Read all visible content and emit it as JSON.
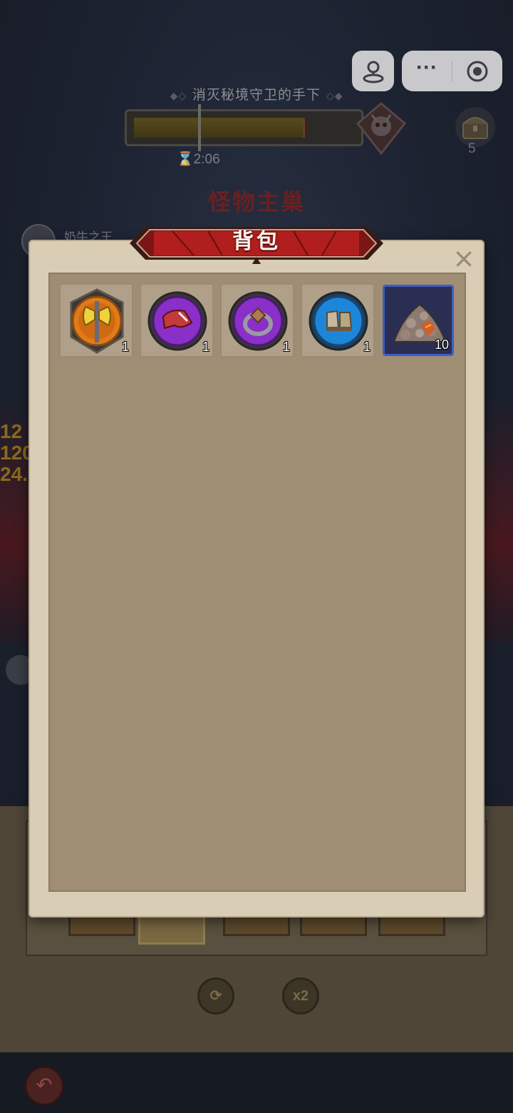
{
  "hud": {
    "mission_title": "消灭秘境守卫的手下",
    "timer": "2:06",
    "chest_count": "5",
    "lair_title": "怪物主巢",
    "player_name": "奶牛之王",
    "side_values": [
      "12",
      "120",
      "24."
    ],
    "x2_label": "x2"
  },
  "mini_program": {
    "more_label": "···"
  },
  "inventory": {
    "title": "背包",
    "close_label": "×",
    "items": [
      {
        "name": "battle-axe-icon",
        "quantity": "1",
        "rarity": "orange"
      },
      {
        "name": "cape-icon",
        "quantity": "1",
        "rarity": "purple"
      },
      {
        "name": "ring-icon",
        "quantity": "1",
        "rarity": "purple"
      },
      {
        "name": "boots-icon",
        "quantity": "1",
        "rarity": "blue"
      },
      {
        "name": "ore-pile-icon",
        "quantity": "10",
        "rarity": "material"
      }
    ],
    "selected_index": 4
  },
  "colors": {
    "orange_frame": "#e07a1a",
    "purple_frame": "#8a2fc8",
    "blue_frame": "#1e86d8",
    "selected_border": "#3c5ec8",
    "banner_red": "#b01e1e"
  }
}
